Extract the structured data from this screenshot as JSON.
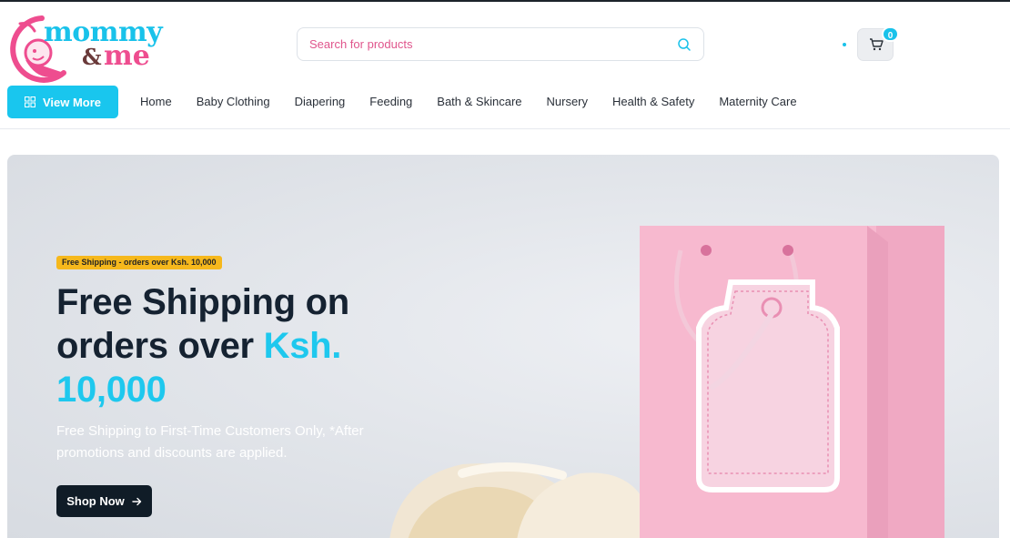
{
  "brand": {
    "line1": "mommy",
    "amp": "&",
    "line2": "me"
  },
  "search": {
    "placeholder": "Search for products"
  },
  "cart": {
    "count": "0"
  },
  "view_more": {
    "label": "View More"
  },
  "nav": [
    {
      "label": "Home"
    },
    {
      "label": "Baby Clothing"
    },
    {
      "label": "Diapering"
    },
    {
      "label": "Feeding"
    },
    {
      "label": "Bath & Skincare"
    },
    {
      "label": "Nursery"
    },
    {
      "label": "Health & Safety"
    },
    {
      "label": "Maternity Care"
    }
  ],
  "hero": {
    "badge": "Free Shipping - orders over Ksh. 10,000",
    "title_part1": "Free Shipping on orders over ",
    "title_accent": "Ksh. 10,000",
    "subtitle": "Free Shipping to First-Time Customers Only, *After promotions and discounts are applied.",
    "cta": "Shop Now"
  },
  "colors": {
    "accent": "#19c6ee",
    "brand_pink": "#ee4d8f",
    "badge_yellow": "#f6b81c",
    "dark": "#101c27"
  },
  "icons": [
    "search-icon",
    "cart-icon",
    "grid-icon",
    "arrow-right-icon"
  ]
}
